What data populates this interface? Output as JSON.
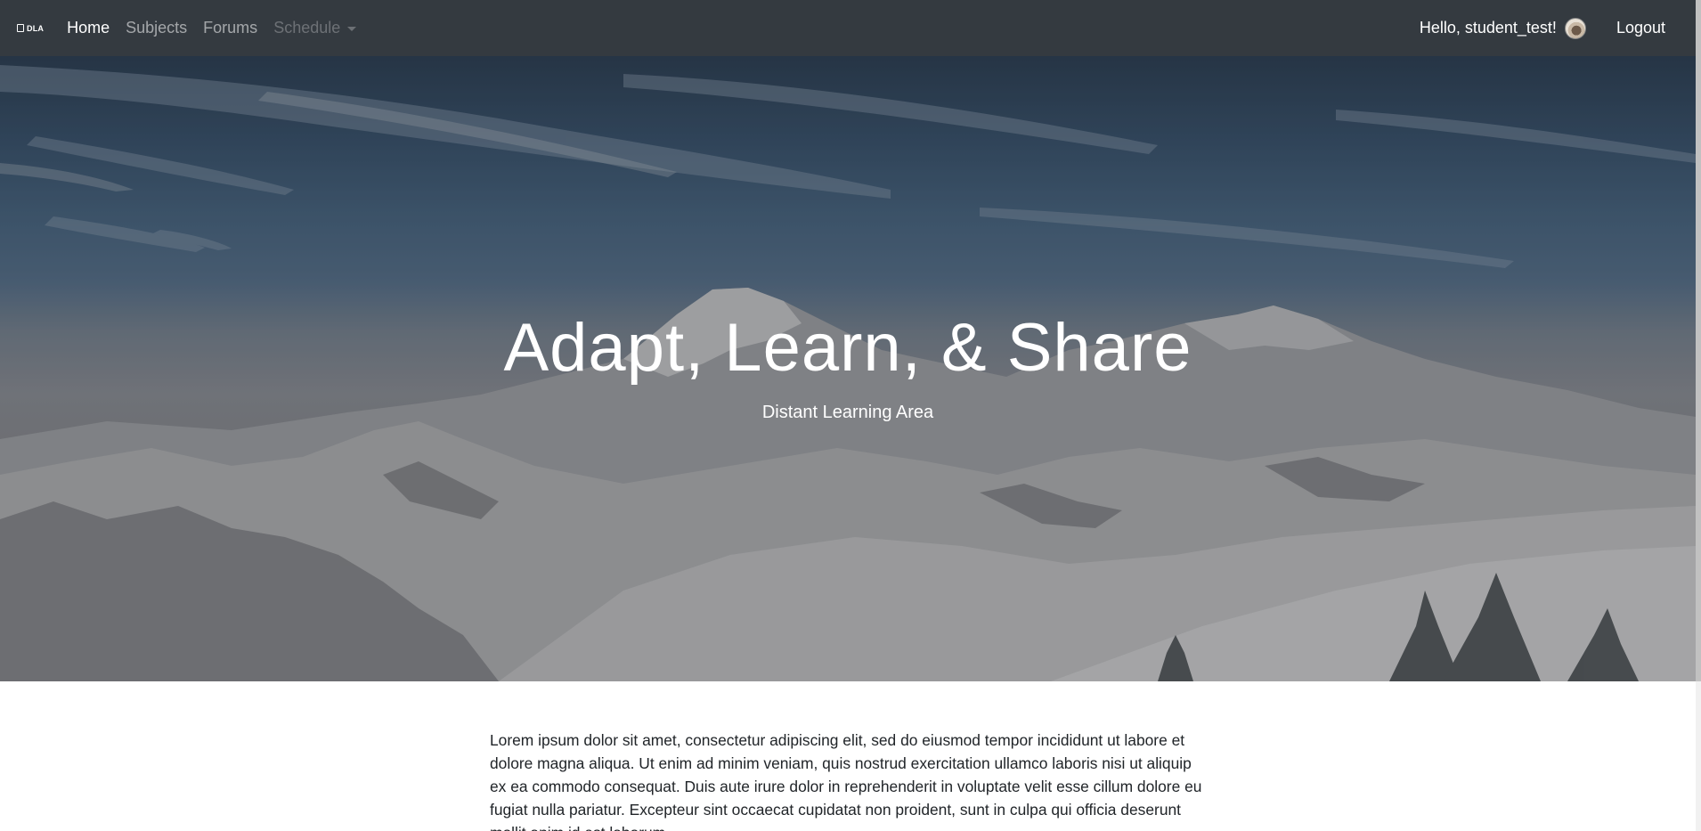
{
  "navbar": {
    "brand": "DLA",
    "links": [
      {
        "label": "Home",
        "state": "active"
      },
      {
        "label": "Subjects",
        "state": "normal"
      },
      {
        "label": "Forums",
        "state": "normal"
      },
      {
        "label": "Schedule",
        "state": "disabled"
      }
    ],
    "greeting": "Hello, student_test!",
    "logout": "Logout"
  },
  "hero": {
    "title": "Adapt, Learn, & Share",
    "subtitle": "Distant Learning Area"
  },
  "content": {
    "paragraph": "Lorem ipsum dolor sit amet, consectetur adipiscing elit, sed do eiusmod tempor incididunt ut labore et dolore magna aliqua. Ut enim ad minim veniam, quis nostrud exercitation ullamco laboris nisi ut aliquip ex ea commodo consequat. Duis aute irure dolor in reprehenderit in voluptate velit esse cillum dolore eu fugiat nulla pariatur. Excepteur sint occaecat cupidatat non proident, sunt in culpa qui officia deserunt mollit anim id est laborum."
  },
  "colors": {
    "navbar_bg": "#343a40",
    "nav_active": "#ffffff",
    "nav_muted": "#9a9da0",
    "text": "#212529"
  }
}
